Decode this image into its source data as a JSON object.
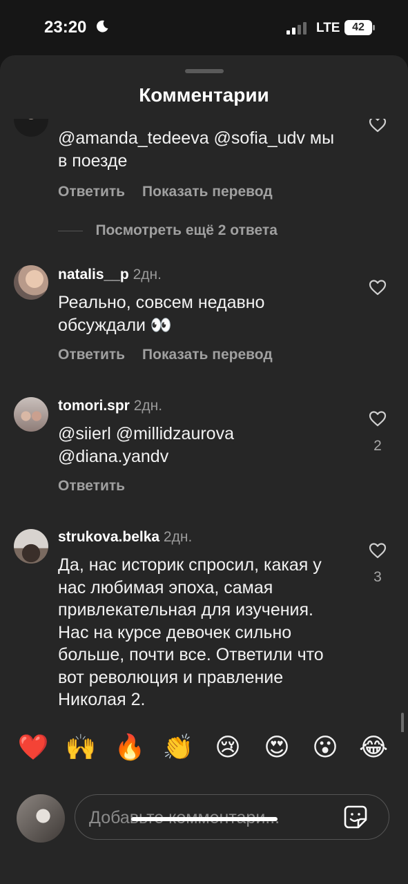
{
  "status_bar": {
    "time": "23:20",
    "network": "LTE",
    "battery": "42"
  },
  "sheet": {
    "title": "Комментарии"
  },
  "comments": [
    {
      "text": "@amanda_tedeeva @sofia_udv мы в поезде",
      "reply": "Ответить",
      "translate": "Показать перевод",
      "more_replies": "Посмотреть ещё 2 ответа"
    },
    {
      "username": "natalis__p",
      "time": "2дн.",
      "text": "Реально, совсем недавно обсуждали 👀",
      "reply": "Ответить",
      "translate": "Показать перевод"
    },
    {
      "username": "tomori.spr",
      "time": "2дн.",
      "text": "@siierl @millidzaurova @diana.yandv",
      "reply": "Ответить",
      "likes": "2"
    },
    {
      "username": "strukova.belka",
      "time": "2дн.",
      "text": "Да, нас историк спросил, какая у нас любимая эпоха, самая привлекательная для изучения. Нас на курсе девочек сильно больше, почти все. Ответили что вот революция и правление Николая 2.",
      "likes": "3"
    }
  ],
  "reactions": [
    "❤️",
    "🙌",
    "🔥",
    "👏",
    "😢",
    "😍",
    "😮",
    "😂"
  ],
  "composer": {
    "placeholder": "Добавьте комментари..."
  },
  "icons": {
    "moon": "moon-icon",
    "signal": "cellular-signal-icon",
    "battery": "battery-icon",
    "heart": "heart-outline-icon",
    "sticker": "sticker-icon"
  },
  "colors": {
    "background": "#161616",
    "sheet": "#262626",
    "secondary_text": "#a0a0a0"
  }
}
